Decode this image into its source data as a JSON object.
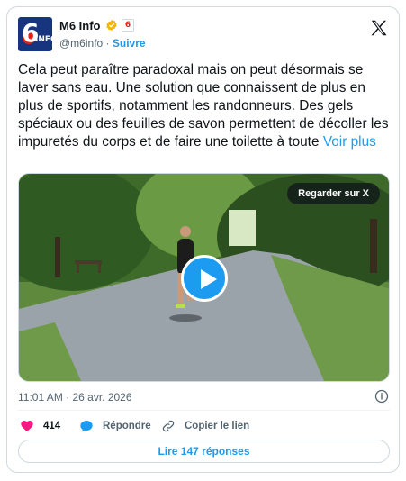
{
  "author": {
    "name": "M6 Info",
    "handle": "@m6info",
    "separator": " · ",
    "follow_label": "Suivre",
    "avatar_six": "6",
    "avatar_info": "INFO",
    "label_badge": "6",
    "verified_color": "#f4b400"
  },
  "tweet": {
    "text": "Cela peut paraître paradoxal mais on peut désormais se laver sans eau. Une solution que connaissent de plus en plus de sportifs, notamment les randonneurs. Des gels spéciaux ou des feuilles de savon permettent de décoller les impuretés du corps et de faire une toilette à toute ",
    "more_label": "Voir plus",
    "timestamp": "11:01 AM · 26 avr. 2026"
  },
  "media": {
    "watch_label": "Regarder sur X"
  },
  "actions": {
    "likes_count": "414",
    "reply_label": "Répondre",
    "copy_label": "Copier le lien",
    "replies_button": "Lire 147 réponses"
  },
  "colors": {
    "accent": "#1d9bf0",
    "like": "#f91880",
    "text": "#0f1419",
    "muted": "#536471"
  }
}
